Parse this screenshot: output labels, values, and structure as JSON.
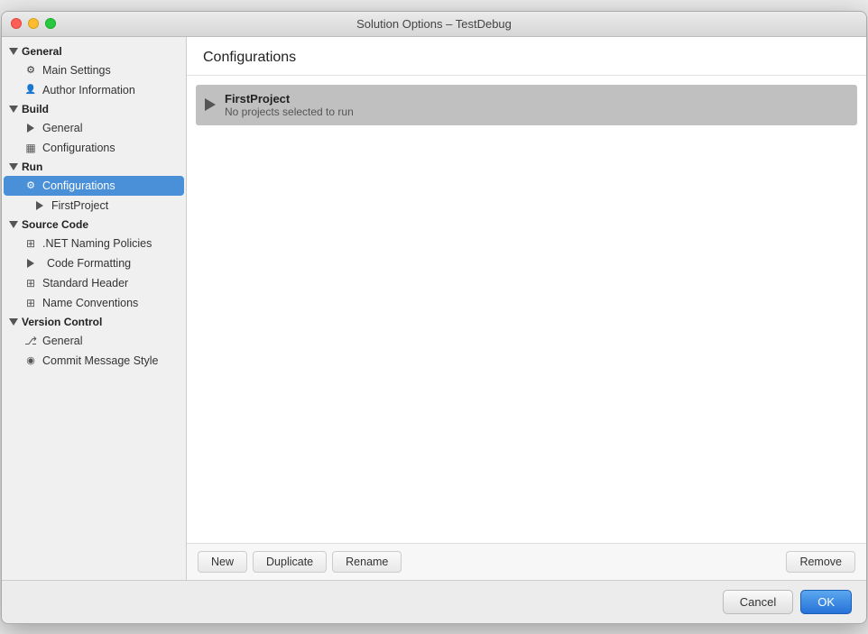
{
  "window": {
    "title": "Solution Options – TestDebug"
  },
  "sidebar": {
    "sections": [
      {
        "id": "general",
        "label": "General",
        "expanded": true,
        "items": [
          {
            "id": "main-settings",
            "label": "Main Settings",
            "icon": "gear",
            "level": 1
          },
          {
            "id": "author-information",
            "label": "Author Information",
            "icon": "user",
            "level": 1
          }
        ]
      },
      {
        "id": "build",
        "label": "Build",
        "expanded": true,
        "items": [
          {
            "id": "build-general",
            "label": "General",
            "icon": "triangle",
            "level": 1
          },
          {
            "id": "build-configurations",
            "label": "Configurations",
            "icon": "grid",
            "level": 1
          }
        ]
      },
      {
        "id": "run",
        "label": "Run",
        "expanded": true,
        "items": [
          {
            "id": "run-configurations",
            "label": "Configurations",
            "icon": "gear",
            "level": 1,
            "active": true
          },
          {
            "id": "run-firstproject",
            "label": "FirstProject",
            "icon": "triangle",
            "level": 2
          }
        ]
      },
      {
        "id": "source-code",
        "label": "Source Code",
        "expanded": true,
        "items": [
          {
            "id": "naming-policies",
            "label": ".NET Naming Policies",
            "icon": "grid2",
            "level": 1
          },
          {
            "id": "code-formatting",
            "label": "Code Formatting",
            "icon": "triangle-grid",
            "level": 1
          },
          {
            "id": "standard-header",
            "label": "Standard Header",
            "icon": "grid2",
            "level": 1
          },
          {
            "id": "name-conventions",
            "label": "Name Conventions",
            "icon": "grid2",
            "level": 1
          }
        ]
      },
      {
        "id": "version-control",
        "label": "Version Control",
        "expanded": true,
        "items": [
          {
            "id": "vc-general",
            "label": "General",
            "icon": "branch",
            "level": 1
          },
          {
            "id": "commit-message-style",
            "label": "Commit Message Style",
            "icon": "commit",
            "level": 1
          }
        ]
      }
    ]
  },
  "content": {
    "title": "Configurations",
    "config_items": [
      {
        "id": "firstproject",
        "name": "FirstProject",
        "description": "No projects selected to run"
      }
    ]
  },
  "toolbar": {
    "new_label": "New",
    "duplicate_label": "Duplicate",
    "rename_label": "Rename",
    "remove_label": "Remove"
  },
  "footer": {
    "cancel_label": "Cancel",
    "ok_label": "OK"
  }
}
